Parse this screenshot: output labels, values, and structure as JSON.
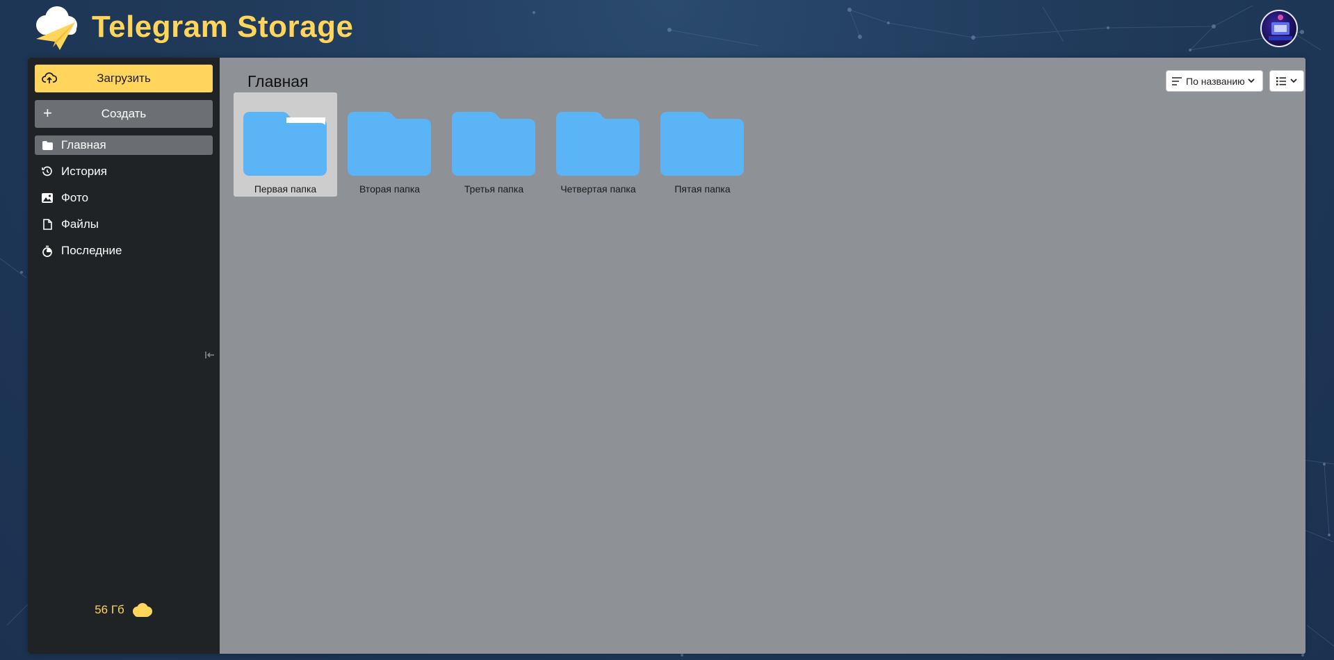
{
  "app": {
    "title": "Telegram Storage",
    "accent": "#ffd55c",
    "folder_color": "#5ab4f6"
  },
  "sidebar": {
    "upload_label": "Загрузить",
    "create_label": "Создать",
    "items": [
      {
        "label": "Главная",
        "icon": "folder-icon",
        "active": true
      },
      {
        "label": "История",
        "icon": "history-icon",
        "active": false
      },
      {
        "label": "Фото",
        "icon": "image-icon",
        "active": false
      },
      {
        "label": "Файлы",
        "icon": "file-icon",
        "active": false
      },
      {
        "label": "Последние",
        "icon": "stopwatch-icon",
        "active": false
      }
    ],
    "storage_label": "56 Гб"
  },
  "content": {
    "title": "Главная",
    "sort_label": "По названию",
    "folders": [
      {
        "name": "Первая папка",
        "selected": true
      },
      {
        "name": "Вторая папка",
        "selected": false
      },
      {
        "name": "Третья папка",
        "selected": false
      },
      {
        "name": "Четвертая папка",
        "selected": false
      },
      {
        "name": "Пятая папка",
        "selected": false
      }
    ]
  }
}
